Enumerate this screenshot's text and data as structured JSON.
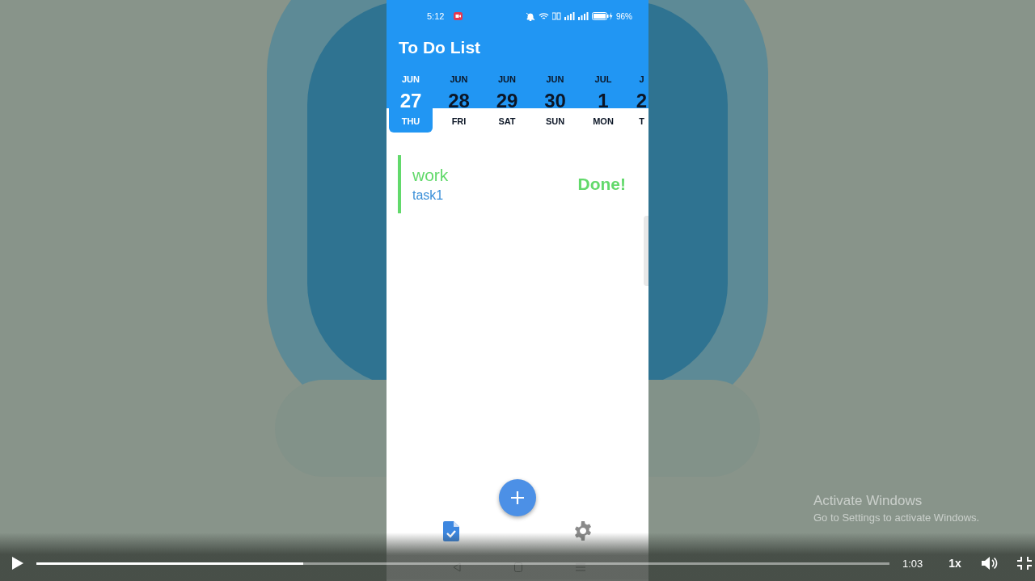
{
  "player": {
    "playing": false,
    "progress": {
      "level": 0.313
    },
    "time": "1:03",
    "speed": "1x"
  },
  "phone": {
    "status_bar": {
      "time": "5:12",
      "battery": "96%"
    },
    "title": "To Do List",
    "days": [
      {
        "month": "JUN",
        "day": "27",
        "weekday": "THU",
        "selected": true
      },
      {
        "month": "JUN",
        "day": "28",
        "weekday": "FRI",
        "selected": false
      },
      {
        "month": "JUN",
        "day": "29",
        "weekday": "SAT",
        "selected": false
      },
      {
        "month": "JUN",
        "day": "30",
        "weekday": "SUN",
        "selected": false
      },
      {
        "month": "JUL",
        "day": "1",
        "weekday": "MON",
        "selected": false
      },
      {
        "month": "J",
        "day": "2",
        "weekday": "T",
        "selected": false
      }
    ],
    "tasks": [
      {
        "title": "work",
        "note": "task1",
        "status": "Done!",
        "color": "#62d96b"
      }
    ],
    "bottom_nav": [
      {
        "kind": "tasks",
        "selected": true
      },
      {
        "kind": "settings",
        "selected": false
      }
    ]
  },
  "os_overlay": {
    "title": "Activate Windows",
    "subtitle": "Go to Settings to activate Windows."
  }
}
